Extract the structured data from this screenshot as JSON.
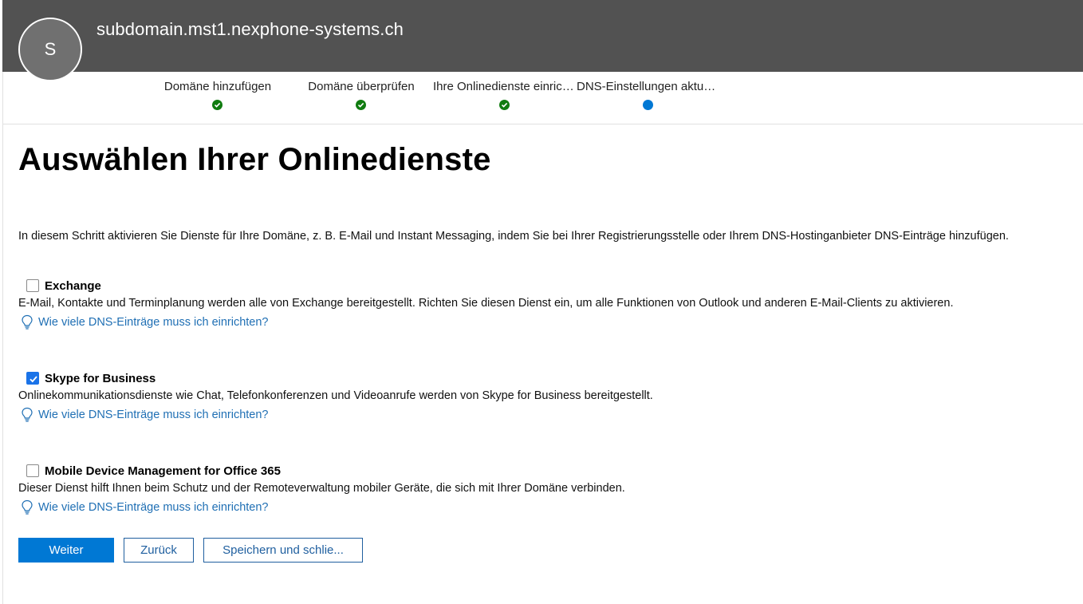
{
  "header": {
    "avatar_initial": "S",
    "domain": "subdomain.mst1.nexphone-systems.ch"
  },
  "steps": [
    {
      "label": "Domäne hinzufügen",
      "status": "done"
    },
    {
      "label": "Domäne überprüfen",
      "status": "done"
    },
    {
      "label": "Ihre Onlinedienste einrichten",
      "status": "done"
    },
    {
      "label": "DNS-Einstellungen aktualisieren",
      "status": "current"
    }
  ],
  "main": {
    "title": "Auswählen Ihrer Onlinedienste",
    "intro": "In diesem Schritt aktivieren Sie Dienste für Ihre Domäne, z. B. E-Mail und Instant Messaging, indem Sie bei Ihrer Registrierungsstelle oder Ihrem DNS-Hostinganbieter DNS-Einträge hinzufügen."
  },
  "services": [
    {
      "name": "Exchange",
      "checked": false,
      "description": "E-Mail, Kontakte und Terminplanung werden alle von Exchange bereitgestellt. Richten Sie diesen Dienst ein, um alle Funktionen von Outlook und anderen E-Mail-Clients zu aktivieren.",
      "link": "Wie viele DNS-Einträge muss ich einrichten?"
    },
    {
      "name": "Skype for Business",
      "checked": true,
      "description": "Onlinekommunikationsdienste wie Chat, Telefonkonferenzen und Videoanrufe werden von Skype for Business bereitgestellt.",
      "link": "Wie viele DNS-Einträge muss ich einrichten?"
    },
    {
      "name": "Mobile Device Management for Office 365",
      "checked": false,
      "description": "Dieser Dienst hilft Ihnen beim Schutz und der Remoteverwaltung mobiler Geräte, die sich mit Ihrer Domäne verbinden.",
      "link": "Wie viele DNS-Einträge muss ich einrichten?"
    }
  ],
  "buttons": {
    "next": "Weiter",
    "back": "Zurück",
    "save_close": "Speichern und schlie..."
  },
  "colors": {
    "header_bg": "#525252",
    "accent": "#0078d4",
    "step_done": "#107c10",
    "link": "#1f6fb4",
    "checkbox_checked": "#1a73e8"
  },
  "icons": {
    "step_done": "check-circle-icon",
    "step_current": "dot-icon",
    "help": "lightbulb-icon"
  }
}
